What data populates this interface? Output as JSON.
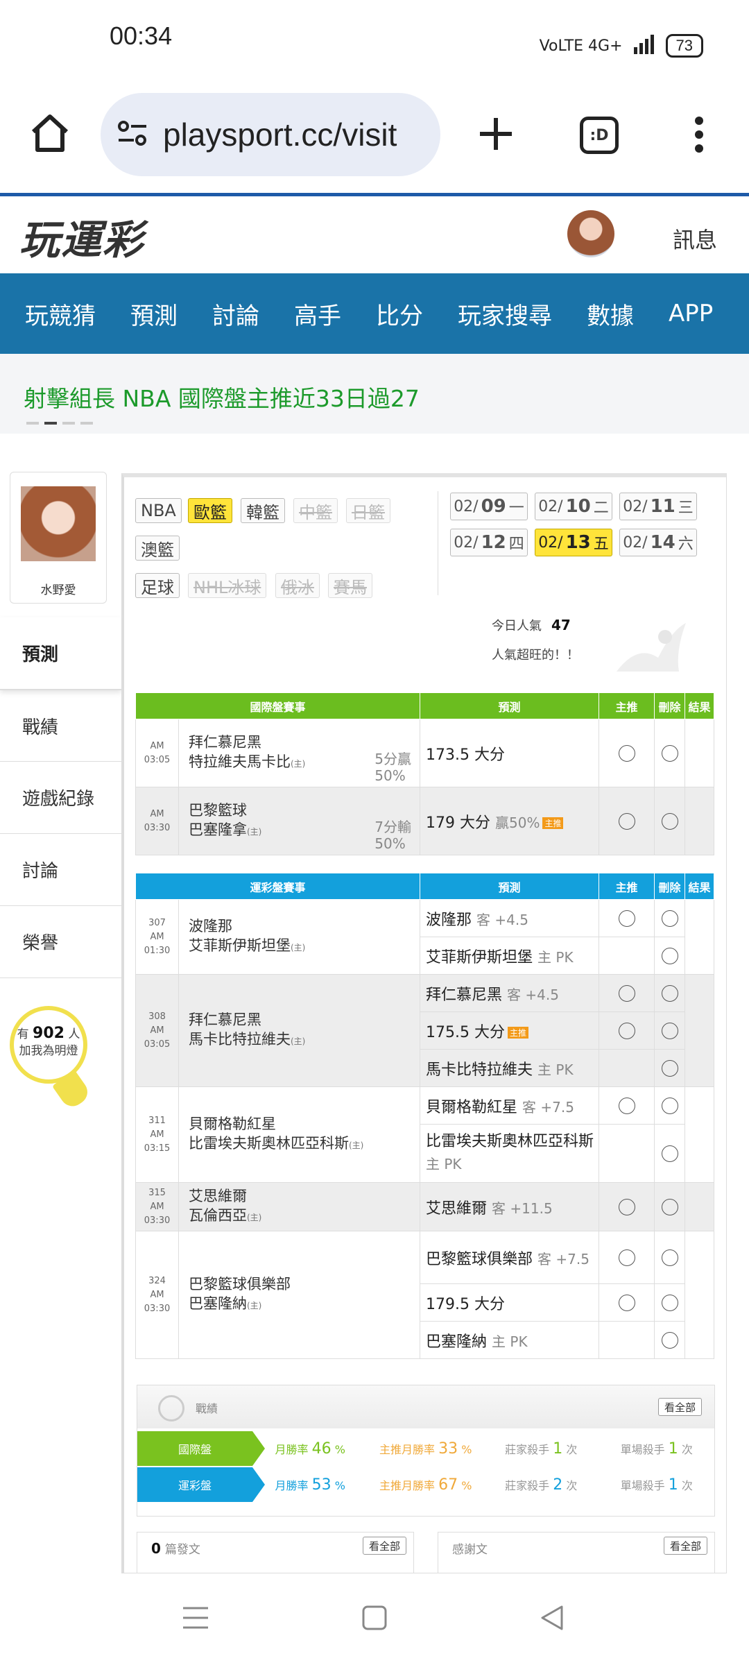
{
  "status": {
    "time": "00:34",
    "network": "VoLTE 4G+",
    "battery": "73"
  },
  "browser": {
    "url": "playsport.cc/visit",
    "tab_label": ":D"
  },
  "site": {
    "logo": "玩運彩",
    "messages": "訊息"
  },
  "nav": [
    "玩競猜",
    "預測",
    "討論",
    "高手",
    "比分",
    "玩家搜尋",
    "數據",
    "APP"
  ],
  "marquee": {
    "text": "射擊組長 NBA 國際盤主推近33日過27"
  },
  "profile": {
    "name": "水野愛"
  },
  "sidebar": [
    "預測",
    "戰績",
    "遊戲紀錄",
    "討論",
    "榮譽"
  ],
  "bulb": {
    "pre": "有",
    "count": "902",
    "unit": "人",
    "line2": "加我為明燈"
  },
  "leagues": [
    {
      "label": "NBA",
      "state": "normal"
    },
    {
      "label": "歐籃",
      "state": "active"
    },
    {
      "label": "韓籃",
      "state": "normal"
    },
    {
      "label": "中籃",
      "state": "disabled"
    },
    {
      "label": "日籃",
      "state": "disabled"
    },
    {
      "label": "澳籃",
      "state": "normal"
    },
    {
      "label": "足球",
      "state": "normal"
    },
    {
      "label": "NHL冰球",
      "state": "disabled"
    },
    {
      "label": "俄冰",
      "state": "disabled"
    },
    {
      "label": "賽馬",
      "state": "disabled"
    }
  ],
  "dates": [
    {
      "md": "02/",
      "d": "09",
      "w": "一"
    },
    {
      "md": "02/",
      "d": "10",
      "w": "二"
    },
    {
      "md": "02/",
      "d": "11",
      "w": "三"
    },
    {
      "md": "02/",
      "d": "12",
      "w": "四"
    },
    {
      "md": "02/",
      "d": "13",
      "w": "五"
    },
    {
      "md": "02/",
      "d": "14",
      "w": "六"
    }
  ],
  "popularity": {
    "label": "今日人氣",
    "value": "47",
    "note": "人氣超旺的！！"
  },
  "intl_table": {
    "headers": [
      "國際盤賽事",
      "預測",
      "主推",
      "刪除",
      "結果"
    ],
    "rows": [
      {
        "time": "AM 03:05",
        "team1": "拜仁慕尼黑",
        "team2": "特拉維夫馬卡比",
        "home": "(主)",
        "hcp1": "5分贏",
        "hcp2": "50%",
        "pred": "173.5 大分",
        "pred_sub": ""
      },
      {
        "time": "AM 03:30",
        "team1": "巴黎籃球",
        "team2": "巴塞隆拿",
        "home": "(主)",
        "hcp1": "7分輸",
        "hcp2": "50%",
        "pred": "179 大分",
        "pred_sub": "贏50%",
        "pred_badge": "主推"
      }
    ]
  },
  "lottery_table": {
    "headers": [
      "運彩盤賽事",
      "預測",
      "主推",
      "刪除",
      "結果"
    ],
    "games": [
      {
        "no": "307",
        "time": "AM 01:30",
        "team1": "波隆那",
        "team2": "艾菲斯伊斯坦堡",
        "home": "(主)",
        "preds": [
          {
            "text": "波隆那",
            "sub": "客 +4.5"
          },
          {
            "text": "艾菲斯伊斯坦堡",
            "sub": "主 PK"
          }
        ]
      },
      {
        "no": "308",
        "time": "AM 03:05",
        "team1": "拜仁慕尼黑",
        "team2": "馬卡比特拉維夫",
        "home": "(主)",
        "preds": [
          {
            "text": "拜仁慕尼黑",
            "sub": "客 +4.5"
          },
          {
            "text": "175.5 大分",
            "sub": "",
            "badge": "主推"
          },
          {
            "text": "馬卡比特拉維夫",
            "sub": "主 PK"
          }
        ]
      },
      {
        "no": "311",
        "time": "AM 03:15",
        "team1": "貝爾格勒紅星",
        "team2": "比雷埃夫斯奧林匹亞科斯",
        "home": "(主)",
        "preds": [
          {
            "text": "貝爾格勒紅星",
            "sub": "客 +7.5"
          },
          {
            "text": "比雷埃夫斯奧林匹亞科斯",
            "sub": "主 PK"
          }
        ]
      },
      {
        "no": "315",
        "time": "AM 03:30",
        "team1": "艾思維爾",
        "team2": "瓦倫西亞",
        "home": "(主)",
        "preds": [
          {
            "text": "艾思維爾",
            "sub": "客 +11.5"
          }
        ]
      },
      {
        "no": "324",
        "time": "AM 03:30",
        "team1": "巴黎籃球俱樂部",
        "team2": "巴塞隆納",
        "home": "(主)",
        "preds": [
          {
            "text": "巴黎籃球俱樂部",
            "sub": "客 +7.5"
          },
          {
            "text": "179.5 大分",
            "sub": ""
          },
          {
            "text": "巴塞隆納",
            "sub": "主 PK"
          }
        ]
      }
    ]
  },
  "record": {
    "title": "戰績",
    "view_all": "看全部",
    "rows": [
      {
        "label": "國際盤",
        "color": "#7ac21f",
        "month_rate_label": "月勝率",
        "month_rate": "46",
        "main_rate_label": "主推月勝率",
        "main_rate": "33",
        "killer_label": "莊家殺手",
        "killer": "1",
        "single_label": "單場殺手",
        "single": "1",
        "unit": "次",
        "pct": "%"
      },
      {
        "label": "運彩盤",
        "color": "#13a0dc",
        "month_rate_label": "月勝率",
        "month_rate": "53",
        "main_rate_label": "主推月勝率",
        "main_rate": "67",
        "killer_label": "莊家殺手",
        "killer": "2",
        "single_label": "單場殺手",
        "single": "1",
        "unit": "次",
        "pct": "%"
      }
    ]
  },
  "posts": {
    "count": "0",
    "label": "篇發文",
    "view_all": "看全部"
  },
  "thanks": {
    "label": "感謝文",
    "view_all": "看全部"
  }
}
